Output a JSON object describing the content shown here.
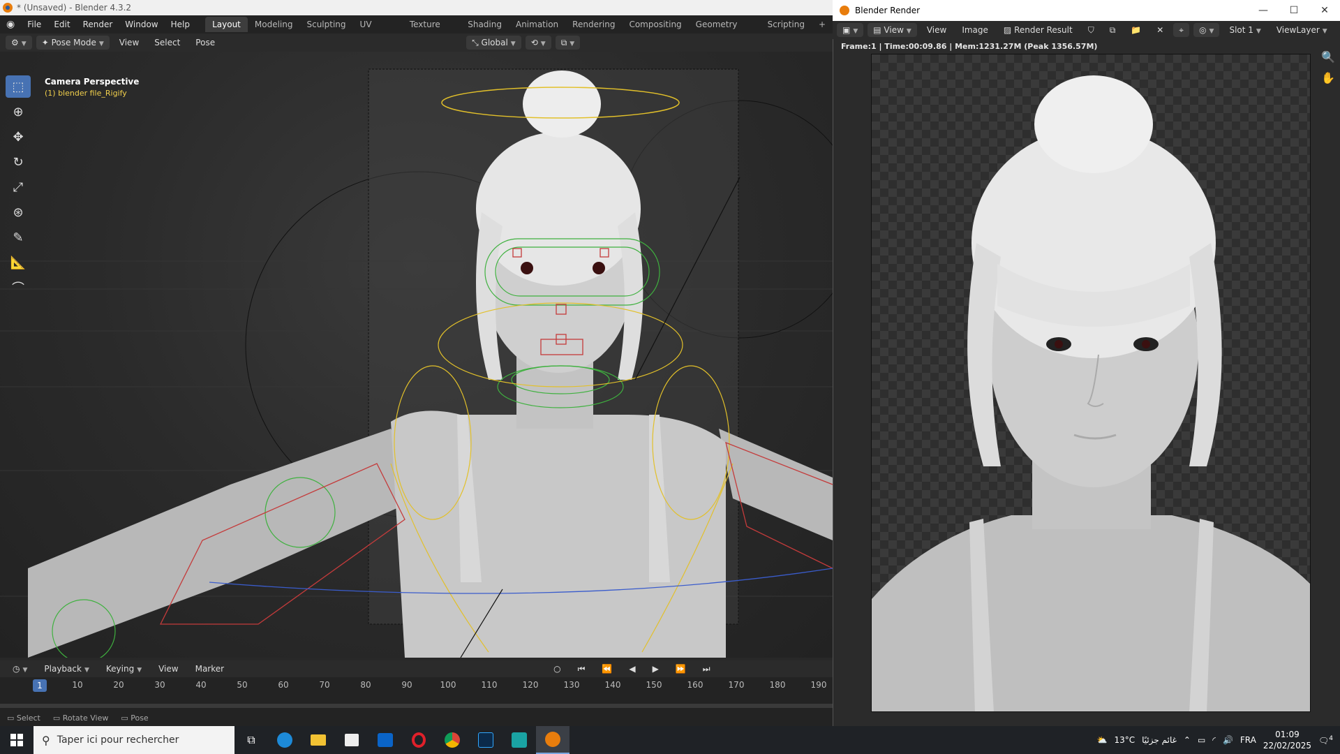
{
  "blender": {
    "title": "* (Unsaved) - Blender 4.3.2",
    "menus": [
      "File",
      "Edit",
      "Render",
      "Window",
      "Help"
    ],
    "workspaces": [
      "Layout",
      "Modeling",
      "Sculpting",
      "UV Editing",
      "Texture Paint",
      "Shading",
      "Animation",
      "Rendering",
      "Compositing",
      "Geometry Nodes",
      "Scripting",
      "+"
    ],
    "active_workspace": "Layout",
    "header": {
      "mode": "Pose Mode",
      "view": "View",
      "select": "Select",
      "pose": "Pose",
      "orientation": "Global"
    },
    "viewport": {
      "title": "Camera Perspective",
      "object": "(1) blender file_Rigify"
    },
    "timeline": {
      "menus": [
        "Playback",
        "Keying",
        "View",
        "Marker"
      ],
      "current_frame": "1",
      "frames": [
        "10",
        "20",
        "30",
        "40",
        "50",
        "60",
        "70",
        "80",
        "90",
        "100",
        "110",
        "120",
        "130",
        "140",
        "150",
        "160",
        "170",
        "180",
        "190"
      ]
    },
    "status": {
      "select": "Select",
      "rotate": "Rotate View",
      "pose": "Pose"
    }
  },
  "render_window": {
    "title": "Blender Render",
    "header": {
      "view": "View",
      "view2": "View",
      "image": "Image",
      "result": "Render Result",
      "slot": "Slot 1",
      "layer": "ViewLayer"
    },
    "info": "Frame:1 | Time:00:09.86 | Mem:1231.27M (Peak 1356.57M)"
  },
  "taskbar": {
    "search_placeholder": "Taper ici pour rechercher",
    "weather": "13°C",
    "weather_text": "غائم جزئيًا",
    "lang": "FRA",
    "time": "01:09",
    "date": "22/02/2025",
    "notif_count": "4"
  },
  "colors": {
    "accent": "#4772b3",
    "rig_yellow": "#e2c02a",
    "rig_green": "#3fb13f",
    "rig_red": "#c43b3b",
    "rig_blue": "#3a5ccc"
  }
}
